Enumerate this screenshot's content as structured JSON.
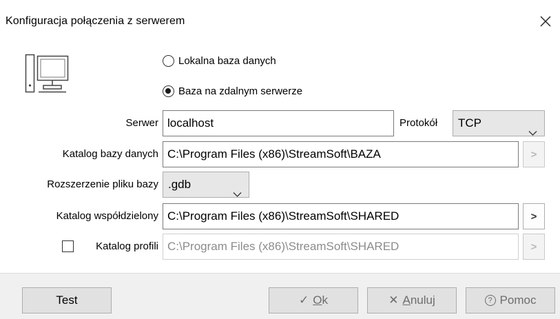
{
  "window": {
    "title": "Konfiguracja połączenia z serwerem",
    "close_icon": "close-icon"
  },
  "connection": {
    "local_label": "Lokalna baza danych",
    "remote_label": "Baza na zdalnym serwerze",
    "selected": "remote"
  },
  "server": {
    "label": "Serwer",
    "value": "localhost",
    "protocol_label": "Protokół",
    "protocol_value": "TCP"
  },
  "database_dir": {
    "label": "Katalog bazy danych",
    "value": "C:\\Program Files (x86)\\StreamSoft\\BAZA",
    "browse_glyph": ">"
  },
  "file_extension": {
    "label": "Rozszerzenie pliku bazy",
    "value": ".gdb"
  },
  "shared_dir": {
    "label": "Katalog współdzielony",
    "value": "C:\\Program Files (x86)\\StreamSoft\\SHARED",
    "browse_glyph": ">"
  },
  "profiles_dir": {
    "label": "Katalog profili",
    "checked": false,
    "value": "C:\\Program Files (x86)\\StreamSoft\\SHARED",
    "browse_glyph": ">"
  },
  "footer": {
    "test_label": "Test",
    "ok_glyph": "✓",
    "ok_mnemonic": "O",
    "ok_rest": "k",
    "cancel_glyph": "✕",
    "cancel_mnemonic": "A",
    "cancel_rest": "nuluj",
    "help_glyph": "?",
    "help_label": "Pomoc"
  },
  "colors": {
    "background": "#ffffff",
    "footer": "#f0f0f0",
    "button": "#e1e1e1",
    "disabled_text": "#8c8c8c"
  }
}
